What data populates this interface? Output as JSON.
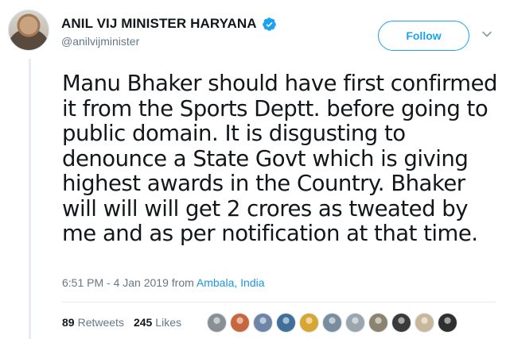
{
  "author": {
    "name": "ANIL VIJ MINISTER HARYANA",
    "handle": "@anilvijminister",
    "verified": true
  },
  "follow_label": "Follow",
  "tweet": {
    "lines": [
      "Manu Bhaker should have first confirmed",
      "it from the Sports Deptt. before going to",
      "public domain. It is disgusting to",
      "denounce a State Govt which is giving",
      "highest awards in the Country. Bhaker",
      "will will will get 2 crores as tweated by",
      "me and as per notification at that time."
    ]
  },
  "meta": {
    "timestamp": "6:51 PM - 4 Jan 2019",
    "from_label": "from",
    "location": "Ambala, India"
  },
  "stats": {
    "retweets_count": "89",
    "retweets_label": "Retweets",
    "likes_count": "245",
    "likes_label": "Likes"
  },
  "colors": {
    "accent": "#1da1f2",
    "link": "#1b95e0",
    "muted": "#657786",
    "text": "#14171a"
  },
  "icons": {
    "verified": "verified-badge-icon",
    "caret": "chevron-down-icon"
  },
  "liker_avatars": [
    {
      "color": "#8a8f96"
    },
    {
      "color": "#c8663e"
    },
    {
      "color": "#6d86a8"
    },
    {
      "color": "#3f6f9a"
    },
    {
      "color": "#d9a531"
    },
    {
      "color": "#7a8d9e"
    },
    {
      "color": "#9aa5ae"
    },
    {
      "color": "#8b8270"
    },
    {
      "color": "#3a3a3a"
    },
    {
      "color": "#c9b79c"
    },
    {
      "color": "#2f2f2f"
    }
  ]
}
